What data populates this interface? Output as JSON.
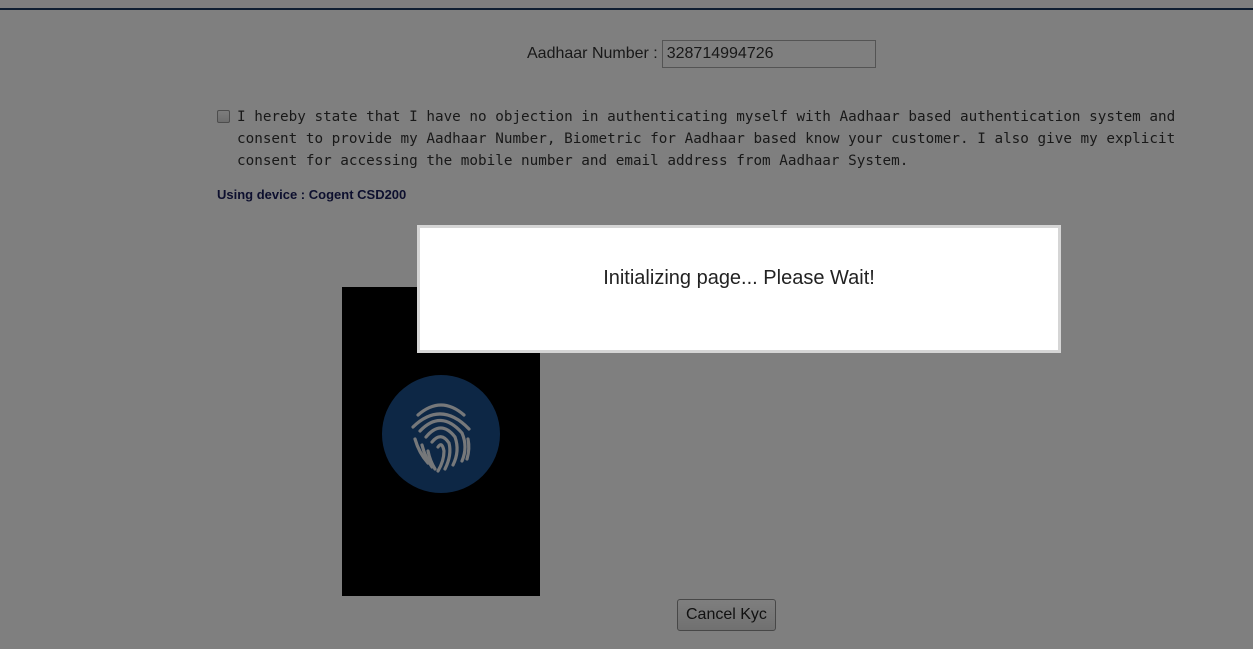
{
  "form": {
    "aadhaar_label": "Aadhaar Number :",
    "aadhaar_value": "328714994726",
    "consent_checked": false,
    "consent_text": "I hereby state that I have no objection in authenticating myself with Aadhaar based authentication system and consent to provide my Aadhaar Number, Biometric for Aadhaar based know your customer. I also give my explicit consent for accessing the mobile number and email address from Aadhaar System.",
    "device_text": "Using device : Cogent CSD200",
    "cancel_label": "Cancel Kyc"
  },
  "scanner": {
    "icon": "fingerprint-icon",
    "icon_color": "#1b4f8a"
  },
  "modal": {
    "message": "Initializing page... Please Wait!"
  },
  "colors": {
    "top_line": "#1f3c63",
    "device_text": "#1a1f5c",
    "overlay": "rgba(0,0,0,0.5)"
  }
}
